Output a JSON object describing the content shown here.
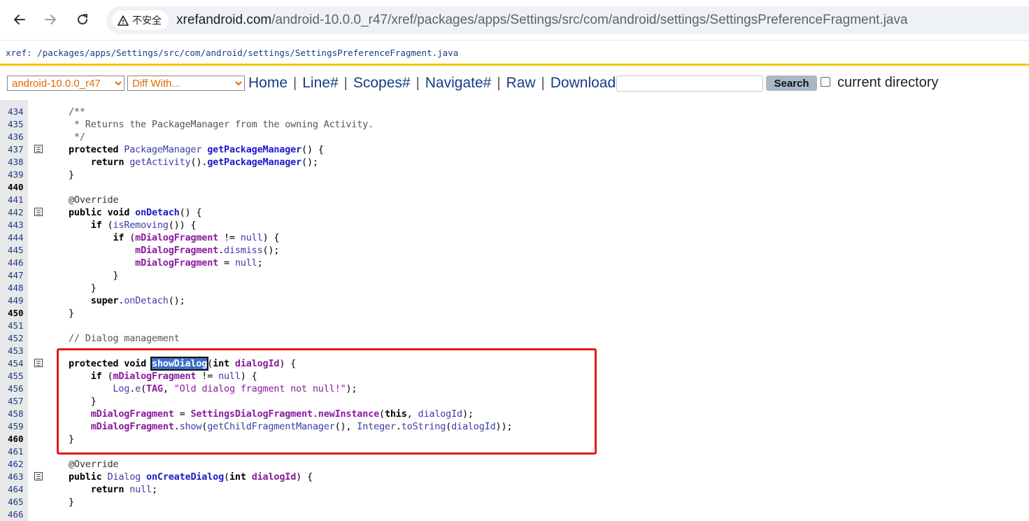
{
  "browser": {
    "security_label": "不安全",
    "url_host": "xrefandroid.com",
    "url_path": "/android-10.0.0_r47/xref/packages/apps/Settings/src/com/android/settings/SettingsPreferenceFragment.java"
  },
  "xref_path": {
    "prefix": "xref:",
    "path": " /packages/apps/Settings/src/com/android/settings/SettingsPreferenceFragment.java"
  },
  "toolbar": {
    "version_selected": "android-10.0.0_r47",
    "diff_selected": "Diff With...",
    "menu": [
      "Home",
      "Line#",
      "Scopes#",
      "Navigate#",
      "Raw",
      "Download"
    ],
    "search_value": "",
    "search_label": "Search",
    "current_directory_label": "current directory"
  },
  "code": {
    "line_numbers": [
      "434",
      "435",
      "436",
      "437",
      "438",
      "439",
      "440",
      "441",
      "442",
      "443",
      "444",
      "445",
      "446",
      "447",
      "448",
      "449",
      "450",
      "451",
      "452",
      "453",
      "454",
      "455",
      "456",
      "457",
      "458",
      "459",
      "460",
      "461",
      "462",
      "463",
      "464",
      "465",
      "466"
    ],
    "bold_lines": [
      "440",
      "450",
      "460"
    ],
    "fold_lines": [
      "437",
      "442",
      "454",
      "463"
    ],
    "lines": [
      "/**",
      " * Returns the PackageManager from the owning Activity.",
      " */",
      "protected PackageManager getPackageManager() {",
      "    return getActivity().getPackageManager();",
      "}",
      "",
      "@Override",
      "public void onDetach() {",
      "    if (isRemoving()) {",
      "        if (mDialogFragment != null) {",
      "            mDialogFragment.dismiss();",
      "            mDialogFragment = null;",
      "        }",
      "    }",
      "    super.onDetach();",
      "}",
      "",
      "// Dialog management",
      "",
      "protected void showDialog(int dialogId) {",
      "    if (mDialogFragment != null) {",
      "        Log.e(TAG, \"Old dialog fragment not null!\");",
      "    }",
      "    mDialogFragment = SettingsDialogFragment.newInstance(this, dialogId);",
      "    mDialogFragment.show(getChildFragmentManager(), Integer.toString(dialogId));",
      "}",
      "",
      "@Override",
      "public Dialog onCreateDialog(int dialogId) {",
      "    return null;",
      "}",
      ""
    ],
    "highlighted_symbol": "showDialog"
  }
}
